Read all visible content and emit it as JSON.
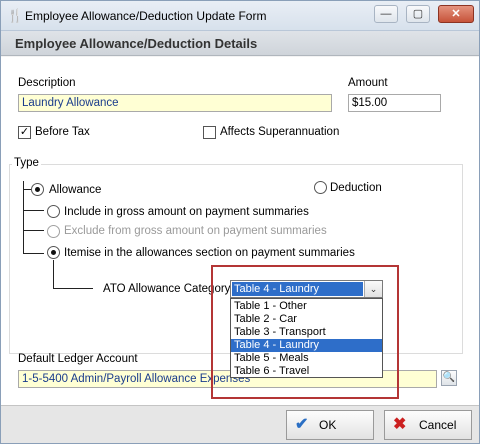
{
  "window": {
    "title": "Employee Allowance/Deduction Update Form",
    "icon": "utensils-icon",
    "controls": {
      "minimize": "—",
      "maximize": "▢",
      "close": "✕"
    }
  },
  "header": {
    "title": "Employee Allowance/Deduction Details"
  },
  "form": {
    "description_label": "Description",
    "description_value": "Laundry Allowance",
    "amount_label": "Amount",
    "amount_value": "$15.00",
    "before_tax_label": "Before Tax",
    "before_tax_checked": true,
    "affects_super_label": "Affects Superannuation",
    "affects_super_checked": false,
    "type_label": "Type",
    "allowance_label": "Allowance",
    "deduction_label": "Deduction",
    "option_include_label": "Include in gross amount on payment summaries",
    "option_exclude_label": "Exclude from gross amount on payment summaries",
    "option_itemise_label": "Itemise in the allowances section on payment summaries",
    "ato_category_label": "ATO Allowance Category",
    "ato_category_selected": "Table 4 - Laundry",
    "ato_category_options": [
      "Table 1 - Other",
      "Table 2 - Car",
      "Table 3 - Transport",
      "Table 4 - Laundry",
      "Table 5 - Meals",
      "Table 6 - Travel"
    ],
    "ato_category_active_index": 3,
    "ledger_label": "Default Ledger Account",
    "ledger_value": "1-5-5400  Admin/Payroll Allowance Expenses"
  },
  "footer": {
    "ok_label": "OK",
    "cancel_label": "Cancel"
  },
  "colors": {
    "highlight_border": "#b43535",
    "selection": "#2e6ec9",
    "input_yellow": "#ffffd4"
  }
}
